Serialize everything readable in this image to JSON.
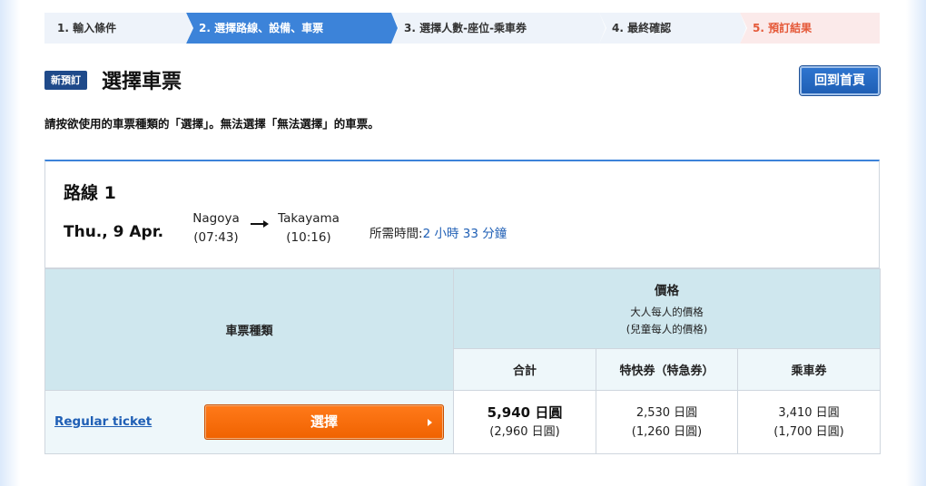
{
  "steps": [
    {
      "label": "1.  輸入條件"
    },
    {
      "label": "2.  選擇路線、設備、車票"
    },
    {
      "label": "3.  選擇人數-座位-乘車券"
    },
    {
      "label": "4.  最終確認"
    },
    {
      "label": "5.  預訂結果"
    }
  ],
  "header": {
    "badge": "新預訂",
    "title": "選擇車票",
    "home_button": "回到首頁"
  },
  "instruction": "請按欲使用的車票種類的「選擇」。無法選擇「無法選擇」的車票。",
  "route": {
    "title": "路線 1",
    "date": "Thu., 9 Apr.",
    "from_station": "Nagoya",
    "from_time": "(07:43)",
    "to_station": "Takayama",
    "to_time": "(10:16)",
    "duration_label": "所需時間:",
    "duration_value": "2 小時 33 分鐘"
  },
  "table": {
    "type_header": "車票種類",
    "price_header": "價格",
    "price_sub1": "大人每人的價格",
    "price_sub2": "(兒童每人的價格)",
    "col_total": "合計",
    "col_express": "特快券（特急券）",
    "col_fare": "乘車券",
    "rows": [
      {
        "ticket_name": "Regular ticket",
        "select_label": "選擇",
        "total_adult": "5,940 日圓",
        "total_child": "(2,960 日圓)",
        "express_adult": "2,530 日圓",
        "express_child": "(1,260 日圓)",
        "fare_adult": "3,410 日圓",
        "fare_child": "(1,700 日圓)"
      }
    ]
  },
  "colors": {
    "accent": "#3c83d9",
    "select_button": "#f06200",
    "badge": "#1f4a8a"
  }
}
